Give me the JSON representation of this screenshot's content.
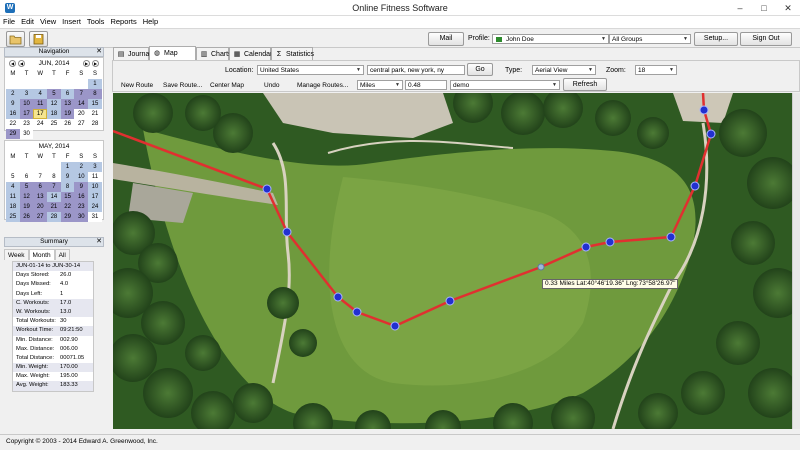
{
  "window": {
    "title": "Online Fitness Software",
    "app_icon": "fitness-app-icon",
    "controls": {
      "minimize": "–",
      "maximize": "□",
      "close": "✕"
    }
  },
  "menu": [
    "File",
    "Edit",
    "View",
    "Insert",
    "Tools",
    "Reports",
    "Help"
  ],
  "toolbar": {
    "icons": [
      "open-folder-icon",
      "save-disk-icon"
    ],
    "mail_label": "Mail",
    "profile_label": "Profile:",
    "profile_value": "John Doe",
    "group_value": "All Groups",
    "setup_label": "Setup...",
    "signout_label": "Sign Out"
  },
  "navigation": {
    "title": "Navigation",
    "close": "✕",
    "dow": [
      "M",
      "T",
      "W",
      "T",
      "F",
      "S",
      "S"
    ],
    "june": {
      "label": "JUN, 2014",
      "days": [
        {
          "d": "",
          "s": "plain"
        },
        {
          "d": "",
          "s": "plain"
        },
        {
          "d": "",
          "s": "plain"
        },
        {
          "d": "",
          "s": "plain"
        },
        {
          "d": "",
          "s": "plain"
        },
        {
          "d": "",
          "s": "plain"
        },
        {
          "d": "1",
          "s": "blue"
        },
        {
          "d": "2",
          "s": "blue"
        },
        {
          "d": "3",
          "s": "blue"
        },
        {
          "d": "4",
          "s": "blue"
        },
        {
          "d": "5",
          "s": "purple"
        },
        {
          "d": "6",
          "s": "blue"
        },
        {
          "d": "7",
          "s": "purple"
        },
        {
          "d": "8",
          "s": "purple"
        },
        {
          "d": "9",
          "s": "blue"
        },
        {
          "d": "10",
          "s": "purple"
        },
        {
          "d": "11",
          "s": "purple"
        },
        {
          "d": "12",
          "s": "blue"
        },
        {
          "d": "13",
          "s": "purple"
        },
        {
          "d": "14",
          "s": "purple"
        },
        {
          "d": "15",
          "s": "blue"
        },
        {
          "d": "16",
          "s": "blue"
        },
        {
          "d": "17",
          "s": "purple"
        },
        {
          "d": "17",
          "s": "today"
        },
        {
          "d": "18",
          "s": "blue"
        },
        {
          "d": "19",
          "s": "purple"
        },
        {
          "d": "20",
          "s": "plain"
        },
        {
          "d": "21",
          "s": "plain"
        },
        {
          "d": "22",
          "s": "plain"
        },
        {
          "d": "23",
          "s": "plain"
        },
        {
          "d": "24",
          "s": "plain"
        },
        {
          "d": "25",
          "s": "plain"
        },
        {
          "d": "26",
          "s": "plain"
        },
        {
          "d": "27",
          "s": "plain"
        },
        {
          "d": "28",
          "s": "plain"
        },
        {
          "d": "29",
          "s": "purple"
        },
        {
          "d": "30",
          "s": "plain"
        }
      ]
    },
    "may": {
      "label": "MAY, 2014",
      "days": [
        {
          "d": "",
          "s": "plain"
        },
        {
          "d": "",
          "s": "plain"
        },
        {
          "d": "",
          "s": "plain"
        },
        {
          "d": "",
          "s": "plain"
        },
        {
          "d": "1",
          "s": "blue"
        },
        {
          "d": "2",
          "s": "blue"
        },
        {
          "d": "3",
          "s": "blue"
        },
        {
          "d": "5",
          "s": "plain"
        },
        {
          "d": "6",
          "s": "plain"
        },
        {
          "d": "7",
          "s": "plain"
        },
        {
          "d": "8",
          "s": "plain"
        },
        {
          "d": "9",
          "s": "blue"
        },
        {
          "d": "10",
          "s": "blue"
        },
        {
          "d": "11",
          "s": "plain"
        },
        {
          "d": "4",
          "s": "blue"
        },
        {
          "d": "5",
          "s": "purple"
        },
        {
          "d": "6",
          "s": "purple"
        },
        {
          "d": "7",
          "s": "purple"
        },
        {
          "d": "8",
          "s": "blue"
        },
        {
          "d": "9",
          "s": "purple"
        },
        {
          "d": "10",
          "s": "blue"
        },
        {
          "d": "11",
          "s": "blue"
        },
        {
          "d": "12",
          "s": "purple"
        },
        {
          "d": "13",
          "s": "purple"
        },
        {
          "d": "14",
          "s": "blue"
        },
        {
          "d": "15",
          "s": "purple"
        },
        {
          "d": "16",
          "s": "purple"
        },
        {
          "d": "17",
          "s": "blue"
        },
        {
          "d": "18",
          "s": "blue"
        },
        {
          "d": "19",
          "s": "purple"
        },
        {
          "d": "20",
          "s": "purple"
        },
        {
          "d": "21",
          "s": "purple"
        },
        {
          "d": "22",
          "s": "purple"
        },
        {
          "d": "23",
          "s": "purple"
        },
        {
          "d": "24",
          "s": "blue"
        },
        {
          "d": "25",
          "s": "blue"
        },
        {
          "d": "26",
          "s": "purple"
        },
        {
          "d": "27",
          "s": "purple"
        },
        {
          "d": "28",
          "s": "blue"
        },
        {
          "d": "29",
          "s": "purple"
        },
        {
          "d": "30",
          "s": "purple"
        },
        {
          "d": "31",
          "s": "plain"
        }
      ]
    }
  },
  "summary": {
    "title": "Summary",
    "close": "✕",
    "tabs": [
      "Week",
      "Month",
      "All"
    ],
    "active_tab": "Month",
    "rows": [
      {
        "k": "JUN-01-14 to JUN-30-14",
        "v": "",
        "shade": true
      },
      {
        "k": "Days Stored:",
        "v": "26.0",
        "shade": false
      },
      {
        "k": "Days Missed:",
        "v": "4.0",
        "shade": false
      },
      {
        "k": "Days Left:",
        "v": "1",
        "shade": false
      },
      {
        "k": "C. Workouts:",
        "v": "17.0",
        "shade": true
      },
      {
        "k": "W. Workouts:",
        "v": "13.0",
        "shade": true
      },
      {
        "k": "Total Workouts:",
        "v": "30",
        "shade": false
      },
      {
        "k": "Workout Time:",
        "v": "09:21:50",
        "shade": true
      },
      {
        "k": "Min. Distance:",
        "v": "002.90",
        "shade": false
      },
      {
        "k": "Max. Distance:",
        "v": "006.00",
        "shade": false
      },
      {
        "k": "Total Distance:",
        "v": "00071.05",
        "shade": false
      },
      {
        "k": "Min. Weight:",
        "v": "170.00",
        "shade": true
      },
      {
        "k": "Max. Weight:",
        "v": "195.00",
        "shade": false
      },
      {
        "k": "Avg. Weight:",
        "v": "183.33",
        "shade": true
      }
    ]
  },
  "tabs": [
    {
      "label": "Journal",
      "icon": "journal-icon"
    },
    {
      "label": "Map Routes",
      "icon": "globe-icon"
    },
    {
      "label": "Charts",
      "icon": "chart-icon"
    },
    {
      "label": "Calendar",
      "icon": "calendar-icon"
    },
    {
      "label": "Statistics",
      "icon": "sigma-icon"
    }
  ],
  "active_tab": "Map Routes",
  "map_options": {
    "location_label": "Location:",
    "location_value": "United States",
    "search_value": "central park, new york, ny",
    "go_label": "Go",
    "type_label": "Type:",
    "type_value": "Aerial View",
    "zoom_label": "Zoom:",
    "zoom_value": "18",
    "new_route": "New Route",
    "save_route": "Save Route...",
    "center_map": "Center Map",
    "undo": "Undo",
    "manage_routes": "Manage Routes...",
    "unit_value": "Miles",
    "distance_value": "0.48",
    "route_name_value": "demo",
    "refresh_label": "Refresh"
  },
  "map": {
    "route_color": "#e03030",
    "waypoint_color": "#2230d0",
    "tooltip": "0.33 Miles Lat:40°46'19.36\" Lng:73°58'26.97\""
  },
  "status": "Copyright © 2003 - 2014 Edward A. Greenwood, Inc."
}
